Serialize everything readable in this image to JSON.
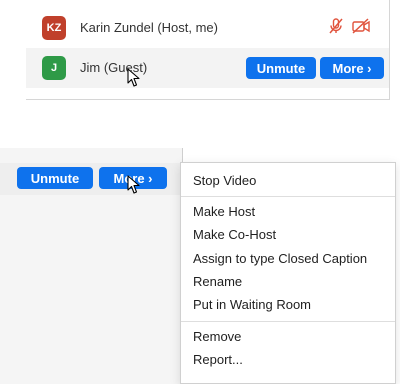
{
  "participants": [
    {
      "initials": "KZ",
      "name": "Karin Zundel (Host, me)",
      "avatar_color": "#c0402b",
      "muted": true,
      "video_off": true
    },
    {
      "initials": "J",
      "name": "Jim (Guest)",
      "avatar_color": "#2e9a47"
    }
  ],
  "row_actions": {
    "unmute": "Unmute",
    "more": "More ›"
  },
  "menu": {
    "group1": [
      "Stop Video"
    ],
    "group2": [
      "Make Host",
      "Make Co-Host",
      "Assign to type Closed Caption",
      "Rename",
      "Put in Waiting Room"
    ],
    "group3": [
      "Remove",
      "Report..."
    ]
  },
  "colors": {
    "primary": "#0e72ed",
    "muted_icon": "#e0533d"
  },
  "icons": {
    "mic": "mic-muted-icon",
    "video": "video-off-icon",
    "cursor": "mouse-pointer-icon"
  }
}
